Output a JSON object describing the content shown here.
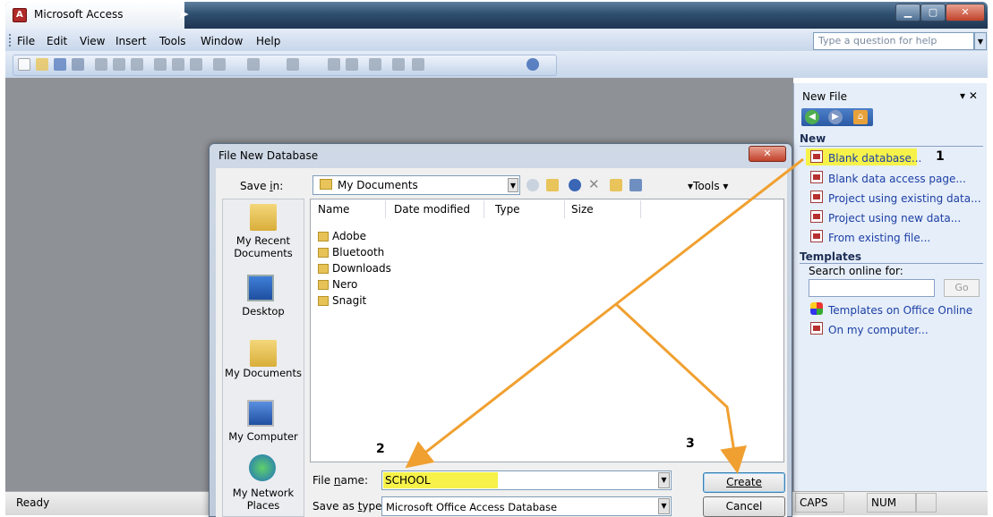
{
  "window": {
    "title": "Microsoft Access",
    "menu": [
      "File",
      "Edit",
      "View",
      "Insert",
      "Tools",
      "Window",
      "Help"
    ],
    "help_placeholder": "Type a question for help"
  },
  "statusbar": {
    "ready": "Ready",
    "caps": "CAPS",
    "num": "NUM"
  },
  "taskpane": {
    "title": "New File",
    "new_section": "New",
    "new_items": [
      "Blank database...",
      "Blank data access page...",
      "Project using existing data...",
      "Project using new data...",
      "From existing file..."
    ],
    "templates_section": "Templates",
    "search_label": "Search online for:",
    "go_label": "Go",
    "template_links": [
      "Templates on Office Online",
      "On my computer..."
    ]
  },
  "dialog": {
    "title": "File New Database",
    "save_in_label": "Save in:",
    "save_in_value": "My Documents",
    "tools_label": "Tools",
    "places": [
      "My Recent Documents",
      "Desktop",
      "My Documents",
      "My Computer",
      "My Network Places"
    ],
    "columns": [
      "Name",
      "Date modified",
      "Type",
      "Size"
    ],
    "files": [
      "Adobe",
      "Bluetooth",
      "Downloads",
      "Nero",
      "Snagit"
    ],
    "file_name_label": "File name:",
    "file_name_value": "SCHOOL",
    "save_as_type_label": "Save as type:",
    "save_as_type_value": "Microsoft Office Access Database",
    "create_label": "Create",
    "cancel_label": "Cancel"
  },
  "annotations": {
    "step1": "1",
    "step2": "2",
    "step3": "3",
    "arrow_color": "#f0a030",
    "highlight_color": "#f6f24a"
  }
}
